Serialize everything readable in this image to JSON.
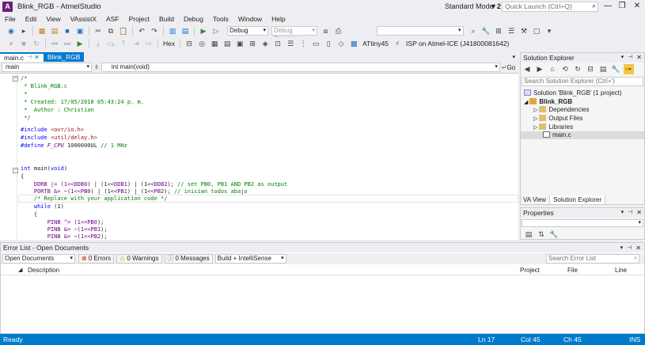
{
  "window": {
    "title": "Blink_RGB - AtmelStudio",
    "mode": "Standard Mode",
    "filter_count": "2",
    "quick_launch_placeholder": "Quick Launch (Ctrl+Q)"
  },
  "menu": [
    "File",
    "Edit",
    "View",
    "VAssistX",
    "ASF",
    "Project",
    "Build",
    "Debug",
    "Tools",
    "Window",
    "Help"
  ],
  "toolbar": {
    "config": "Debug",
    "debug_browser": "Debug Browser",
    "hex_label": "Hex",
    "device": "ATtiny45",
    "tool": "ISP on Atmel-ICE (J41800081642)"
  },
  "editor": {
    "tabs": [
      {
        "label": "main.c"
      },
      {
        "label": "Blink_RGB"
      }
    ],
    "nav_scope": "main",
    "nav_function": "int main(void)",
    "go_label": "Go"
  },
  "code": {
    "l1": "/*",
    "l2": " * Blink_RGB.c",
    "l3": " *",
    "l4": " * Created: 17/05/2018 05:43:24 p. m.",
    "l5": " *  Author : Christian",
    "l6": " */",
    "l8a": "#include ",
    "l8b": "<avr/io.h>",
    "l9a": "#include ",
    "l9b": "<util/delay.h>",
    "l10a": "#define ",
    "l10b": "F_CPU",
    "l10c": " 1000000UL ",
    "l10d": "// 1 MHz",
    "l13a": "int",
    "l13b": " main(",
    "l13c": "void",
    "l13d": ")",
    "l14": "{",
    "l15a": "    DDRB |= (1<<",
    "l15b": "DDB0",
    "l15c": ") | (1<<",
    "l15d": "DDB1",
    "l15e": ") | (1<<",
    "l15f": "DDB2",
    "l15g": "); ",
    "l15h": "// set PB0, PB1 AND PB2 as output",
    "l16a": "    PORTB &= ~(1<<",
    "l16b": "PB0",
    "l16c": ") | (1<<",
    "l16d": "PB1",
    "l16e": ") | (1<<",
    "l16f": "PB2",
    "l16g": "); ",
    "l16h": "// inician todos abajo",
    "l17": "    /* Replace with your application code */",
    "l18a": "    ",
    "l18b": "while",
    "l18c": " (1)",
    "l19": "    {",
    "l20a": "        PINB ^= (1<<",
    "l20b": "PB0",
    "l20c": ");",
    "l21a": "        PINB &= ~(1<<",
    "l21b": "PB1",
    "l21c": ");",
    "l22a": "        PINB &= ~(1<<",
    "l22b": "PB2",
    "l22c": ");"
  },
  "solution_explorer": {
    "title": "Solution Explorer",
    "search_placeholder": "Search Solution Explorer (Ctrl+')",
    "tree": [
      "Solution 'Blink_RGB' (1 project)",
      "Blink_RGB",
      "Dependencies",
      "Output Files",
      "Libraries",
      "main.c"
    ],
    "bottom_tabs": [
      "VA View",
      "Solution Explorer"
    ]
  },
  "properties": {
    "title": "Properties"
  },
  "error_list": {
    "title": "Error List - Open Documents",
    "scope": "Open Documents",
    "errors": "0 Errors",
    "warnings": "0 Warnings",
    "messages": "0 Messages",
    "build_filter": "Build + IntelliSense",
    "search_placeholder": "Search Error List",
    "columns": [
      "Description",
      "Project",
      "File",
      "Line"
    ]
  },
  "status": {
    "ready": "Ready",
    "line": "Ln 17",
    "col": "Col 45",
    "ch": "Ch 45",
    "ins": "INS"
  },
  "colors": {
    "accent": "#007acc",
    "comment": "#008000",
    "keyword": "#0000ff",
    "macro": "#6f008a"
  }
}
